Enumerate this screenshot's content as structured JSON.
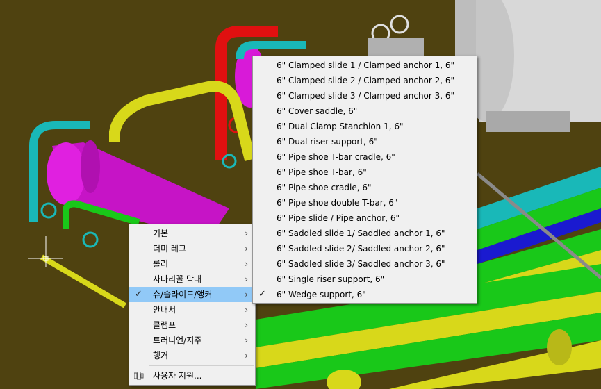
{
  "main_menu": {
    "items": [
      {
        "label": "기본"
      },
      {
        "label": "더미 레그"
      },
      {
        "label": "롤러"
      },
      {
        "label": "사다리꼴 막대"
      },
      {
        "label": "슈/슬라이드/앵커"
      },
      {
        "label": "안내서"
      },
      {
        "label": "클램프"
      },
      {
        "label": "트러니언/지주"
      },
      {
        "label": "행거"
      }
    ],
    "user_support_label": "사용자 지원...",
    "highlight_color": "#91c9f7"
  },
  "submenu": {
    "items": [
      {
        "label": "6\" Clamped slide 1 / Clamped anchor 1, 6\""
      },
      {
        "label": "6\" Clamped slide 2 / Clamped anchor 2, 6\""
      },
      {
        "label": "6\" Clamped slide 3 / Clamped anchor 3, 6\""
      },
      {
        "label": "6\" Cover saddle, 6\""
      },
      {
        "label": "6\" Dual Clamp Stanchion 1, 6\""
      },
      {
        "label": "6\" Dual riser support, 6\""
      },
      {
        "label": "6\" Pipe shoe T-bar cradle, 6\""
      },
      {
        "label": "6\" Pipe shoe T-bar, 6\""
      },
      {
        "label": "6\" Pipe shoe cradle, 6\""
      },
      {
        "label": "6\" Pipe shoe double T-bar, 6\""
      },
      {
        "label": "6\" Pipe slide / Pipe anchor, 6\""
      },
      {
        "label": "6\" Saddled slide 1/ Saddled anchor 1, 6\""
      },
      {
        "label": "6\" Saddled slide 2/ Saddled anchor 2, 6\""
      },
      {
        "label": "6\" Saddled slide 3/ Saddled anchor 3, 6\""
      },
      {
        "label": "6\" Single riser support, 6\""
      },
      {
        "label": "6\" Wedge support, 6\""
      }
    ]
  },
  "viewport": {
    "background_color": "#4f4210"
  }
}
